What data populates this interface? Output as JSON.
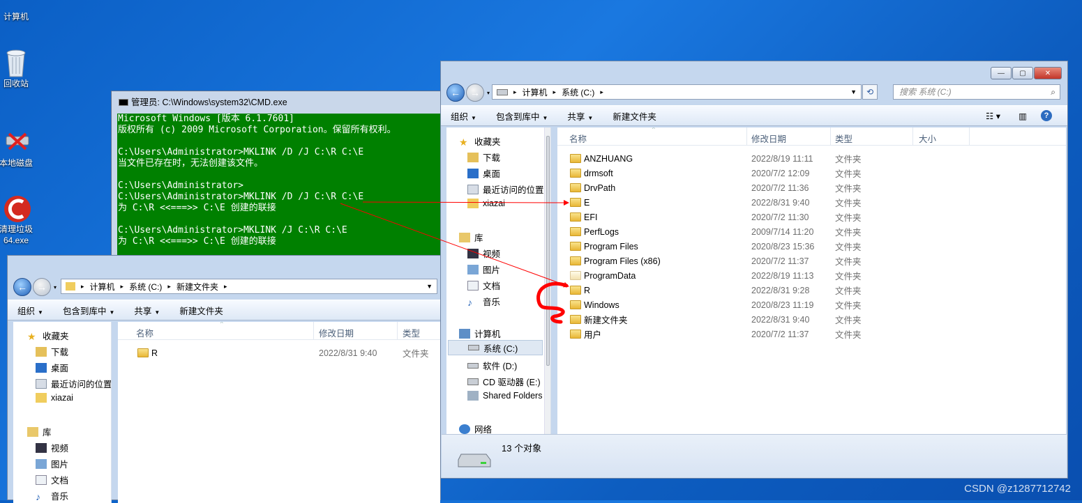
{
  "desktop": {
    "icons": [
      {
        "label": "计算机"
      },
      {
        "label": "回收站"
      },
      {
        "label": "本地磁盘"
      },
      {
        "label": "清理垃圾\n64.exe"
      }
    ],
    "watermark": "CSDN @z1287712742"
  },
  "cmd": {
    "title": "管理员: C:\\Windows\\system32\\CMD.exe",
    "lines": [
      "Microsoft Windows [版本 6.1.7601]",
      "版权所有 (c) 2009 Microsoft Corporation。保留所有权利。",
      "",
      "C:\\Users\\Administrator>MKLINK /D /J C:\\R C:\\E",
      "当文件已存在时，无法创建该文件。",
      "",
      "C:\\Users\\Administrator>",
      "C:\\Users\\Administrator>MKLINK /D /J C:\\R C:\\E",
      "为 C:\\R <<===>> C:\\E 创建的联接",
      "",
      "C:\\Users\\Administrator>MKLINK /J C:\\R C:\\E",
      "为 C:\\R <<===>> C:\\E 创建的联接"
    ]
  },
  "explorerA": {
    "breadcrumb": [
      "计算机",
      "系统 (C:)"
    ],
    "search_placeholder": "搜索 系统 (C:)",
    "toolbar": {
      "organize": "组织",
      "include": "包含到库中",
      "share": "共享",
      "new_folder": "新建文件夹"
    },
    "nav": {
      "favorites": "收藏夹",
      "downloads": "下载",
      "desktop": "桌面",
      "recent": "最近访问的位置",
      "xiazai": "xiazai",
      "libraries": "库",
      "videos": "视频",
      "pictures": "图片",
      "documents": "文档",
      "music": "音乐",
      "computer": "计算机",
      "drive_c": "系统 (C:)",
      "drive_d": "软件 (D:)",
      "drive_e": "CD 驱动器 (E:)",
      "shared": "Shared Folders",
      "network": "网络"
    },
    "columns": {
      "name": "名称",
      "date": "修改日期",
      "type": "类型",
      "size": "大小"
    },
    "rows": [
      {
        "name": "ANZHUANG",
        "date": "2022/8/19 11:11",
        "type": "文件夹"
      },
      {
        "name": "drmsoft",
        "date": "2020/7/2 12:09",
        "type": "文件夹"
      },
      {
        "name": "DrvPath",
        "date": "2020/7/2 11:36",
        "type": "文件夹"
      },
      {
        "name": "E",
        "date": "2022/8/31 9:40",
        "type": "文件夹"
      },
      {
        "name": "EFI",
        "date": "2020/7/2 11:30",
        "type": "文件夹"
      },
      {
        "name": "PerfLogs",
        "date": "2009/7/14 11:20",
        "type": "文件夹"
      },
      {
        "name": "Program Files",
        "date": "2020/8/23 15:36",
        "type": "文件夹"
      },
      {
        "name": "Program Files (x86)",
        "date": "2020/7/2 11:37",
        "type": "文件夹"
      },
      {
        "name": "ProgramData",
        "date": "2022/8/19 11:13",
        "type": "文件夹"
      },
      {
        "name": "R",
        "date": "2022/8/31 9:28",
        "type": "文件夹"
      },
      {
        "name": "Windows",
        "date": "2020/8/23 11:19",
        "type": "文件夹"
      },
      {
        "name": "新建文件夹",
        "date": "2022/8/31 9:40",
        "type": "文件夹"
      },
      {
        "name": "用户",
        "date": "2020/7/2 11:37",
        "type": "文件夹"
      }
    ],
    "status": "13 个对象"
  },
  "explorerB": {
    "breadcrumb": [
      "计算机",
      "系统 (C:)",
      "新建文件夹"
    ],
    "toolbar": {
      "organize": "组织",
      "include": "包含到库中",
      "share": "共享",
      "new_folder": "新建文件夹"
    },
    "nav": {
      "favorites": "收藏夹",
      "downloads": "下载",
      "desktop": "桌面",
      "recent": "最近访问的位置",
      "xiazai": "xiazai",
      "libraries": "库",
      "videos": "视频",
      "pictures": "图片",
      "documents": "文档",
      "music": "音乐"
    },
    "columns": {
      "name": "名称",
      "date": "修改日期",
      "type": "类型"
    },
    "rows": [
      {
        "name": "R",
        "date": "2022/8/31 9:40",
        "type": "文件夹"
      }
    ]
  },
  "colors": {
    "cmd_bg": "#008000",
    "annotation": "#ff0000",
    "desktop": "#1a78e0"
  }
}
